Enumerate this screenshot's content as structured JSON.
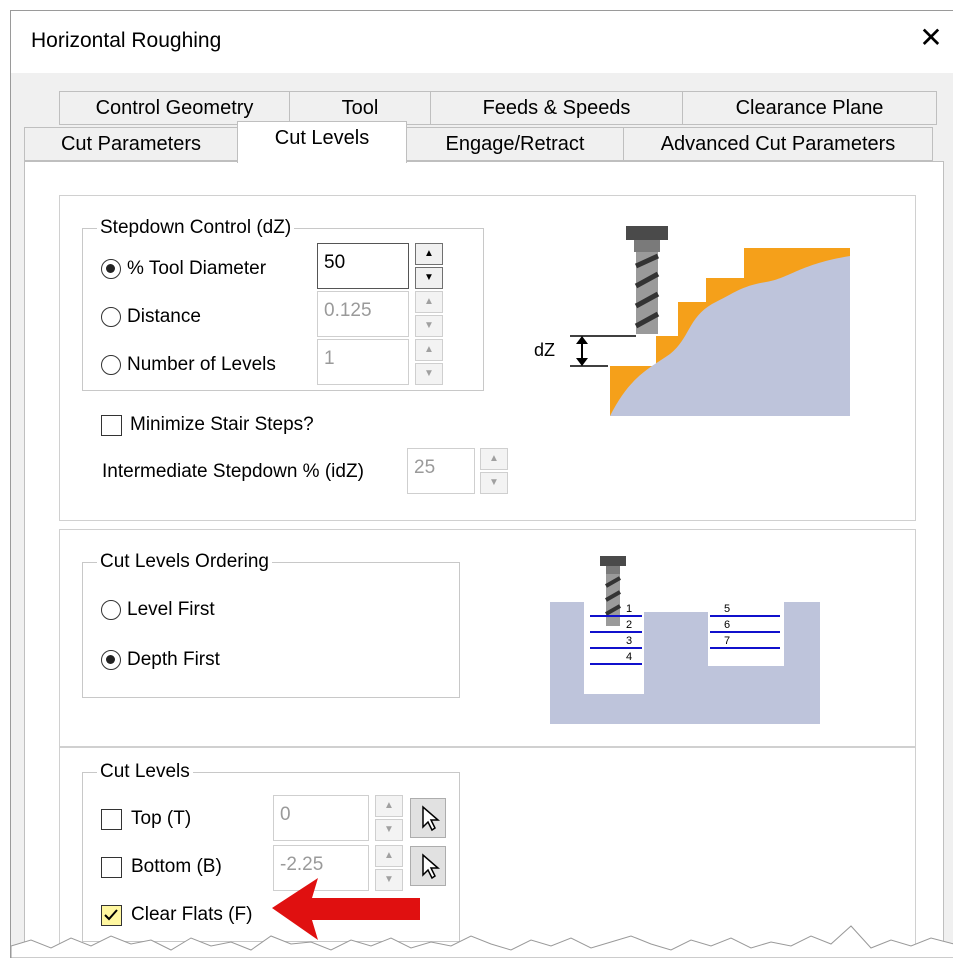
{
  "window": {
    "title": "Horizontal Roughing",
    "close_symbol": "✕"
  },
  "tabs": {
    "row1": [
      "Control Geometry",
      "Tool",
      "Feeds & Speeds",
      "Clearance Plane"
    ],
    "row2": [
      "Cut Parameters",
      "Cut Levels",
      "Engage/Retract",
      "Advanced Cut Parameters"
    ],
    "active": "Cut Levels"
  },
  "stepdown": {
    "group_label": "Stepdown Control (dZ)",
    "options": [
      {
        "label": "% Tool Diameter",
        "value": "50",
        "selected": true,
        "enabled": true
      },
      {
        "label": "Distance",
        "value": "0.125",
        "selected": false,
        "enabled": false
      },
      {
        "label": "Number of Levels",
        "value": "1",
        "selected": false,
        "enabled": false
      }
    ],
    "minimize_label": "Minimize Stair Steps?",
    "minimize_checked": false,
    "intermediate_label": "Intermediate Stepdown % (idZ)",
    "intermediate_value": "25",
    "diagram_label": "dZ"
  },
  "ordering": {
    "group_label": "Cut Levels Ordering",
    "options": [
      {
        "label": "Level First",
        "selected": false
      },
      {
        "label": "Depth First",
        "selected": true
      }
    ],
    "diagram_numbers": [
      "1",
      "2",
      "3",
      "4",
      "5",
      "6",
      "7"
    ]
  },
  "cut_levels": {
    "group_label": "Cut Levels",
    "top": {
      "label": "Top (T)",
      "value": "0",
      "checked": false
    },
    "bottom": {
      "label": "Bottom (B)",
      "value": "-2.25",
      "checked": false
    },
    "clear_flats": {
      "label": "Clear Flats (F)",
      "checked": true
    }
  },
  "colors": {
    "accent_orange": "#f5a01a",
    "material": "#bec4db",
    "arrow_red": "#e01010",
    "check_yellow": "#fff7a0",
    "level_line": "#1010cc"
  },
  "icons": [
    "close-icon",
    "spin-up-icon",
    "spin-down-icon",
    "select-pointer-icon",
    "annotation-arrow-icon"
  ]
}
